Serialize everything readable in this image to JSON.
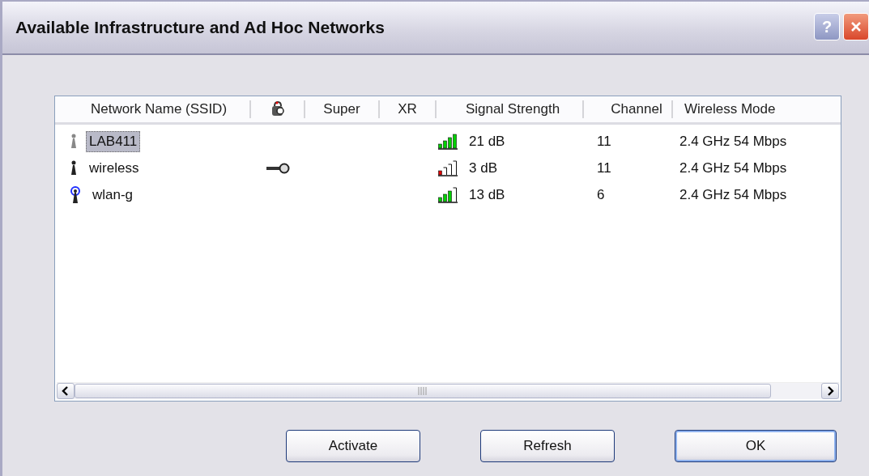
{
  "window": {
    "title": "Available Infrastructure and Ad Hoc Networks",
    "controls": [
      {
        "kind": "help",
        "label": "?"
      },
      {
        "kind": "close"
      }
    ]
  },
  "table": {
    "columns": [
      {
        "kind": "text",
        "label": "Network Name (SSID)"
      },
      {
        "kind": "icon"
      },
      {
        "kind": "text",
        "label": "Super"
      },
      {
        "kind": "text",
        "label": "XR"
      },
      {
        "kind": "text",
        "label": "Signal Strength"
      },
      {
        "kind": "text",
        "label": "Channel"
      },
      {
        "kind": "text",
        "label": "Wireless Mode"
      }
    ],
    "rows": [
      {
        "kind": "access-point",
        "name": "LAB411",
        "selected": true,
        "encrypted": false,
        "level": 1,
        "signal": "21 dB",
        "channel": "11",
        "mode": "2.4 GHz 54 Mbps"
      },
      {
        "kind": "access-point",
        "name": "wireless",
        "selected": false,
        "encrypted": true,
        "level": 0.25,
        "signal": "3 dB",
        "channel": "11",
        "mode": "2.4 GHz 54 Mbps"
      },
      {
        "kind": "adhoc",
        "name": "wlan-g",
        "selected": false,
        "encrypted": false,
        "level": 0.75,
        "signal": "13 dB",
        "channel": "6",
        "mode": "2.4 GHz 54 Mbps"
      }
    ]
  },
  "buttons": [
    {
      "label": "Activate",
      "default": false
    },
    {
      "label": "Refresh",
      "default": false
    },
    {
      "label": "OK",
      "default": true
    }
  ]
}
